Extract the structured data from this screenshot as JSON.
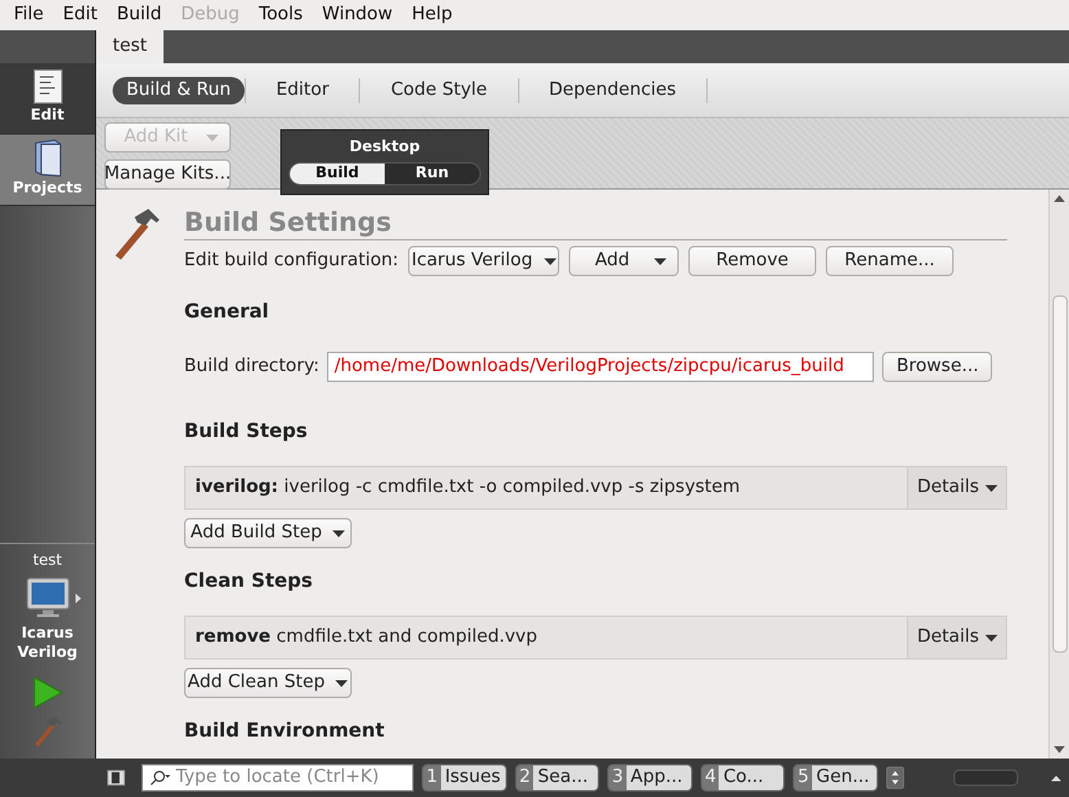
{
  "menu": [
    {
      "label": "File",
      "disabled": false
    },
    {
      "label": "Edit",
      "disabled": false
    },
    {
      "label": "Build",
      "disabled": false
    },
    {
      "label": "Debug",
      "disabled": true
    },
    {
      "label": "Tools",
      "disabled": false
    },
    {
      "label": "Window",
      "disabled": false
    },
    {
      "label": "Help",
      "disabled": false
    }
  ],
  "project_tabs": [
    {
      "label": "test",
      "selected": true
    }
  ],
  "modes": [
    {
      "label": "Edit",
      "kind": "edit",
      "selected": true
    },
    {
      "label": "Projects",
      "kind": "projects",
      "selected": false
    }
  ],
  "target": {
    "project": "test",
    "config": "Icarus Verilog"
  },
  "settings_tabs": [
    {
      "label": "Build & Run",
      "selected": true
    },
    {
      "label": "Editor",
      "selected": false
    },
    {
      "label": "Code Style",
      "selected": false
    },
    {
      "label": "Dependencies",
      "selected": false
    }
  ],
  "kit_buttons": [
    {
      "label": "Add Kit",
      "disabled": true,
      "dropdown": true
    },
    {
      "label": "Manage Kits...",
      "disabled": false,
      "dropdown": false
    }
  ],
  "kit": {
    "name": "Desktop",
    "modes": [
      {
        "label": "Build",
        "selected": true
      },
      {
        "label": "Run",
        "selected": false
      }
    ]
  },
  "build_settings": {
    "title": "Build Settings",
    "config_label": "Edit build configuration:",
    "config_value": "Icarus Verilog",
    "buttons": [
      {
        "label": "Add",
        "dropdown": true
      },
      {
        "label": "Remove",
        "dropdown": false
      },
      {
        "label": "Rename...",
        "dropdown": false
      }
    ]
  },
  "general": {
    "heading": "General",
    "dir_label": "Build directory:",
    "dir_value": "/home/me/Downloads/VerilogProjects/zipcpu/icarus_build",
    "browse": "Browse..."
  },
  "step_sections": [
    {
      "heading": "Build Steps",
      "steps": [
        {
          "name": "iverilog:",
          "detail": "iverilog -c cmdfile.txt -o compiled.vvp -s zipsystem",
          "details": "Details"
        }
      ],
      "add": "Add Build Step"
    },
    {
      "heading": "Clean Steps",
      "steps": [
        {
          "name": "remove",
          "detail": "cmdfile.txt and compiled.vvp",
          "details": "Details"
        }
      ],
      "add": "Add Clean Step"
    }
  ],
  "env_heading": "Build Environment",
  "progress": {
    "level": 0
  },
  "locator": {
    "placeholder": "Type to locate (Ctrl+K)"
  },
  "output_panes": [
    {
      "number": "1",
      "label": "Issues"
    },
    {
      "number": "2",
      "label": "Sea..."
    },
    {
      "number": "3",
      "label": "App..."
    },
    {
      "number": "4",
      "label": "Co..."
    },
    {
      "number": "5",
      "label": "Gen..."
    }
  ]
}
